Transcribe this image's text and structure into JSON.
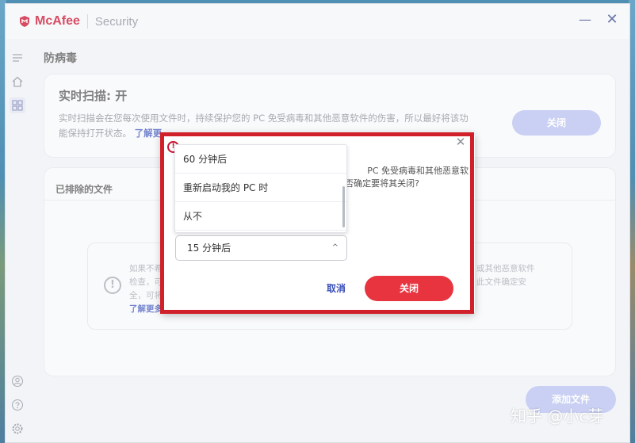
{
  "window": {
    "brand": "McAfee",
    "product": "Security",
    "minimize_icon": "minimize-icon",
    "close_icon": "close-icon"
  },
  "sidebar": {
    "icons": [
      "menu-icon",
      "home-icon",
      "apps-grid-icon",
      "account-icon",
      "help-icon",
      "settings-icon"
    ]
  },
  "page": {
    "title": "防病毒"
  },
  "realtime": {
    "title": "实时扫描: 开",
    "desc_line1": "实时扫描会在您每次使用文件时，持续保护您的 PC 免受病毒和其他恶意软件的伤害，所以最好将该功",
    "desc_line2": "能保持打开状态。",
    "link": "了解更",
    "off_button": "关闭"
  },
  "excluded": {
    "title": "已排除的文件",
    "info_left": [
      "如果不希",
      "检查，可",
      "全，可将"
    ],
    "info_left_link": "了解更多",
    "info_right": [
      "或其他恶意软件",
      "此文件确定安"
    ],
    "add_button": "添加文件"
  },
  "dialog": {
    "message_line1": "PC 免受病毒和其他恶意软",
    "message_line2": "否确定要将其关闭?",
    "options": [
      "60 分钟后",
      "重新启动我的 PC 时",
      "从不"
    ],
    "selected": "15 分钟后",
    "cancel": "取消",
    "confirm": "关闭"
  },
  "watermark": "知乎 @小c芽",
  "colors": {
    "brand_red": "#c8102e",
    "accent_blue": "#3a4fb8",
    "disabled_button": "#b9c1ef",
    "confirm_red": "#e8343f",
    "highlight_red": "#d0202a"
  }
}
